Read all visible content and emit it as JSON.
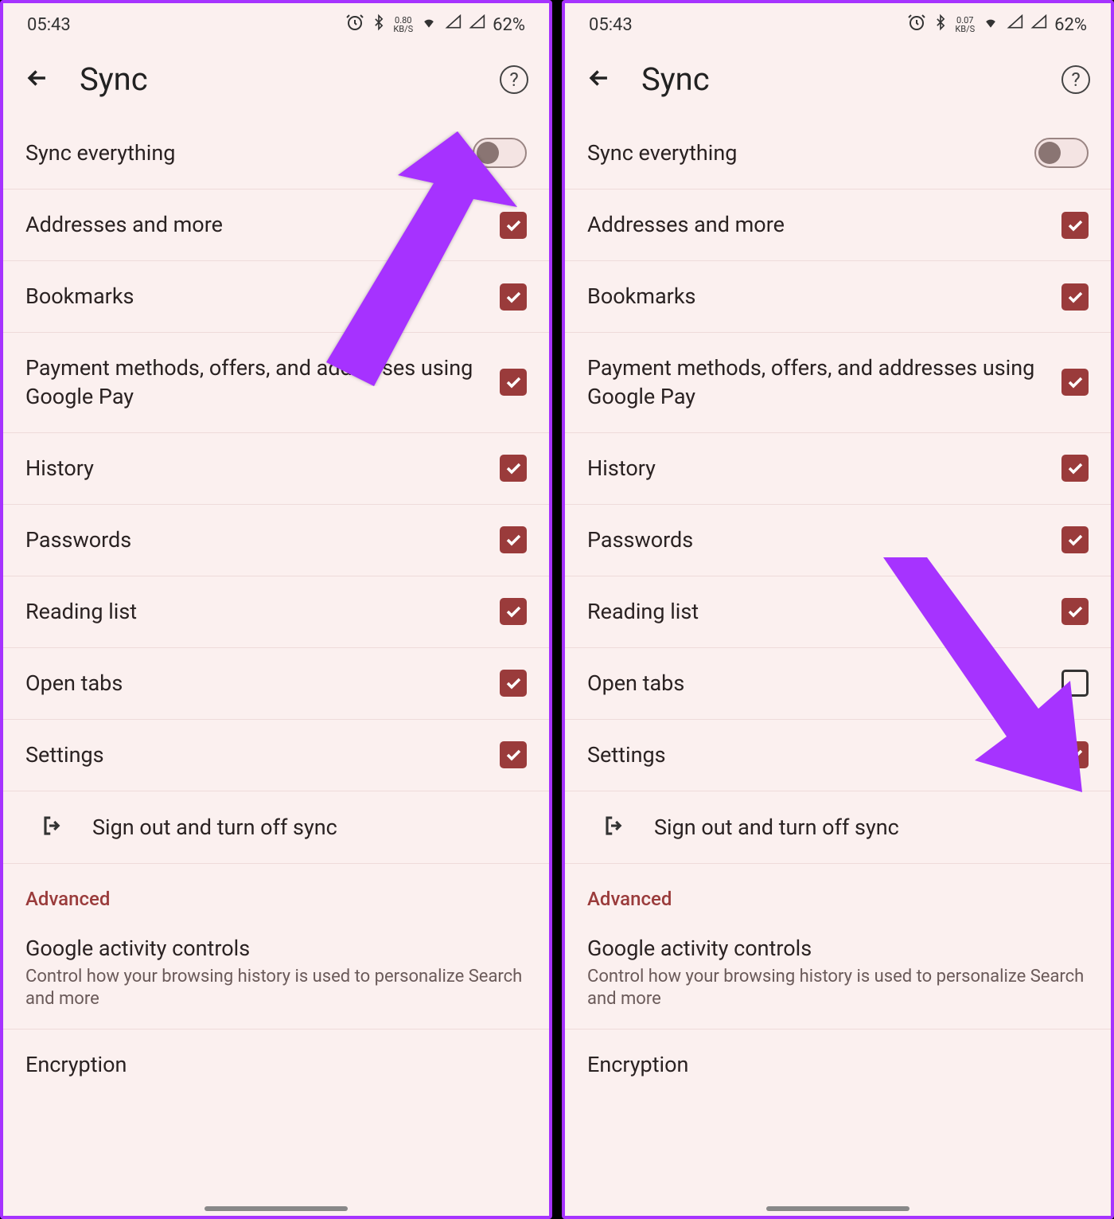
{
  "statusbar": {
    "time": "05:43",
    "kbs_value": "0.80",
    "kbs_unit": "KB/S",
    "kbs_value2": "0.07",
    "battery": "62%"
  },
  "header": {
    "title": "Sync"
  },
  "sync_everything": {
    "label": "Sync everything",
    "on": false
  },
  "items": [
    {
      "label": "Addresses and more",
      "checked": true
    },
    {
      "label": "Bookmarks",
      "checked": true
    },
    {
      "label": "Payment methods, offers, and addresses using Google Pay",
      "checked": true
    },
    {
      "label": "History",
      "checked": true
    },
    {
      "label": "Passwords",
      "checked": true
    },
    {
      "label": "Reading list",
      "checked": true
    },
    {
      "label": "Open tabs",
      "checked": true
    },
    {
      "label": "Settings",
      "checked": true
    }
  ],
  "items_right": [
    {
      "label": "Addresses and more",
      "checked": true
    },
    {
      "label": "Bookmarks",
      "checked": true
    },
    {
      "label": "Payment methods, offers, and addresses using Google Pay",
      "checked": true
    },
    {
      "label": "History",
      "checked": true
    },
    {
      "label": "Passwords",
      "checked": true
    },
    {
      "label": "Reading list",
      "checked": true
    },
    {
      "label": "Open tabs",
      "checked": false
    },
    {
      "label": "Settings",
      "checked": true
    }
  ],
  "signout_label": "Sign out and turn off sync",
  "advanced_label": "Advanced",
  "gac": {
    "title": "Google activity controls",
    "desc": "Control how your browsing history is used to personalize Search and more"
  },
  "encryption_label": "Encryption"
}
